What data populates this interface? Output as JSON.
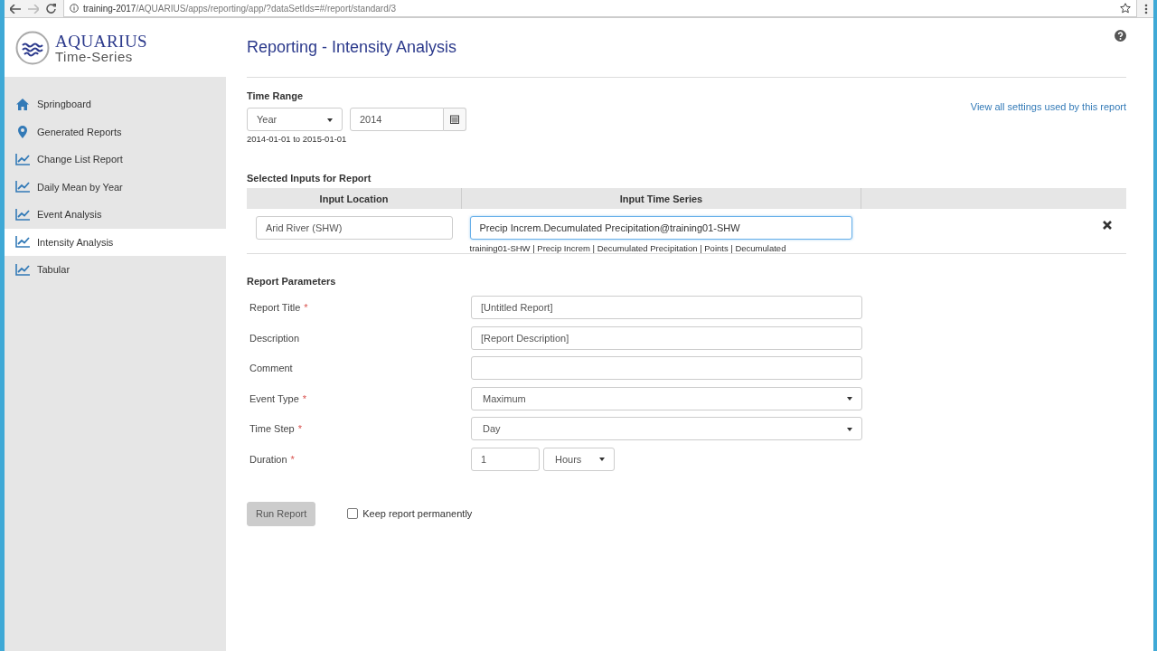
{
  "browser": {
    "url_host": "training-2017",
    "url_path": "/AQUARIUS/apps/reporting/app/?dataSetIds=#/report/standard/3"
  },
  "logo": {
    "name": "AQUARIUS",
    "tagline": "Time-Series"
  },
  "sidebar": {
    "items": [
      {
        "label": "Springboard",
        "kind": "home",
        "selected": false
      },
      {
        "label": "Generated Reports",
        "kind": "pin",
        "selected": false
      },
      {
        "label": "Change List Report",
        "kind": "chart",
        "selected": false
      },
      {
        "label": "Daily Mean by Year",
        "kind": "chart",
        "selected": false
      },
      {
        "label": "Event Analysis",
        "kind": "chart",
        "selected": false
      },
      {
        "label": "Intensity Analysis",
        "kind": "chart",
        "selected": true
      },
      {
        "label": "Tabular",
        "kind": "chart",
        "selected": false
      }
    ]
  },
  "page": {
    "title": "Reporting - Intensity Analysis"
  },
  "time_range": {
    "label": "Time Range",
    "period": "Year",
    "year": "2014",
    "range": "2014-01-01 to 2015-01-01"
  },
  "settings_link": "View all settings used by this report",
  "inputs": {
    "title": "Selected Inputs for Report",
    "columns": [
      "Input Location",
      "Input Time Series"
    ],
    "rows": [
      {
        "location": "Arid River (SHW)",
        "series": "Precip Increm.Decumulated Precipitation@training01-SHW",
        "details": "training01-SHW | Precip Increm | Decumulated Precipitation | Points | Decumulated"
      }
    ]
  },
  "parameters": {
    "title": "Report Parameters",
    "fields": [
      {
        "label": "Report Title",
        "required_mark": "*",
        "kind": "text",
        "value": "[Untitled Report]"
      },
      {
        "label": "Description",
        "kind": "text",
        "value": "[Report Description]"
      },
      {
        "label": "Comment",
        "kind": "text"
      },
      {
        "label": "Event Type",
        "required_mark": "*",
        "kind": "select",
        "value": "Maximum"
      },
      {
        "label": "Time Step",
        "required_mark": "*",
        "kind": "select",
        "value": "Day"
      },
      {
        "label": "Duration",
        "required_mark": "*",
        "kind": "number_unit",
        "value": "1",
        "unit": "Hours"
      }
    ]
  },
  "actions": {
    "run_button": "Run Report",
    "run_disabled": true,
    "keep_label": "Keep report permanently",
    "keep_checked": false
  }
}
